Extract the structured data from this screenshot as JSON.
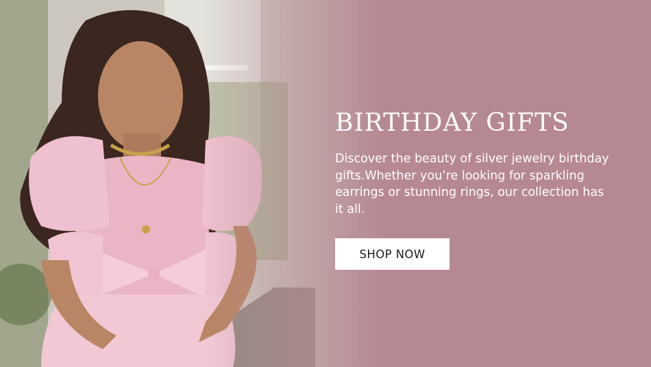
{
  "banner": {
    "title": "BIRTHDAY GIFTS",
    "description": "Discover the beauty of silver jewelry birthday gifts.Whether you’re looking for sparkling earrings or stunning rings, our collection has it all.",
    "cta_label": "SHOP NOW",
    "colors": {
      "background": "#b68892",
      "text": "#ffffff",
      "button_bg": "#ffffff",
      "button_text": "#1b1b1b"
    }
  },
  "image": {
    "subject": "girl in pink ruffled dress wearing necklace",
    "icon": "photo"
  }
}
